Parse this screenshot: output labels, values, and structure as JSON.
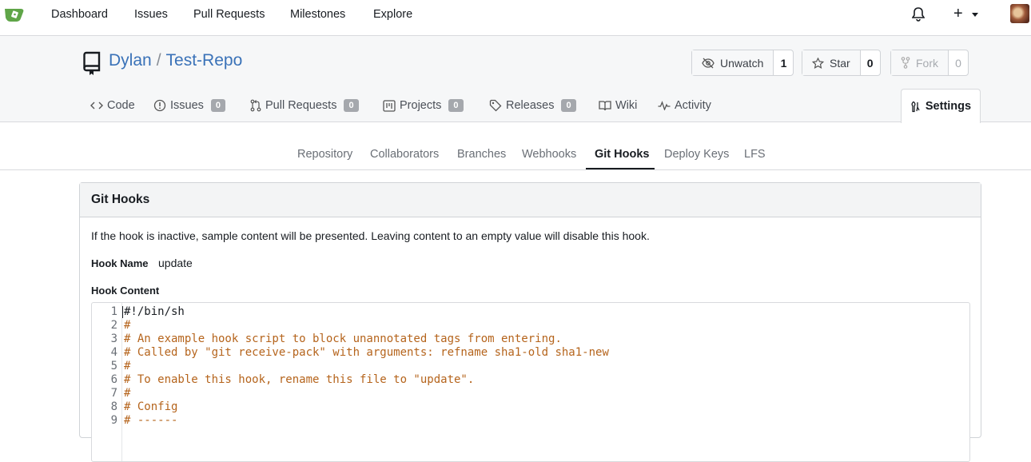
{
  "nav": {
    "items": [
      "Dashboard",
      "Issues",
      "Pull Requests",
      "Milestones",
      "Explore"
    ],
    "plus": "+"
  },
  "repo": {
    "owner": "Dylan",
    "separator": "/",
    "name": "Test-Repo",
    "watch": {
      "label": "Unwatch",
      "count": "1"
    },
    "star": {
      "label": "Star",
      "count": "0"
    },
    "fork": {
      "label": "Fork",
      "count": "0"
    }
  },
  "tabs": {
    "code": "Code",
    "issues": {
      "label": "Issues",
      "count": "0"
    },
    "pulls": {
      "label": "Pull Requests",
      "count": "0"
    },
    "projects": {
      "label": "Projects",
      "count": "0"
    },
    "releases": {
      "label": "Releases",
      "count": "0"
    },
    "wiki": "Wiki",
    "activity": "Activity",
    "settings": "Settings"
  },
  "subnav": {
    "items": [
      "Repository",
      "Collaborators",
      "Branches",
      "Webhooks",
      "Git Hooks",
      "Deploy Keys",
      "LFS"
    ],
    "active": "Git Hooks"
  },
  "panel": {
    "title": "Git Hooks",
    "description": "If the hook is inactive, sample content will be presented. Leaving content to an empty value will disable this hook.",
    "hook_name_label": "Hook Name",
    "hook_name_value": "update",
    "hook_content_label": "Hook Content"
  },
  "editor": {
    "lines": [
      {
        "n": "1",
        "text": "#!/bin/sh"
      },
      {
        "n": "2",
        "text": "#"
      },
      {
        "n": "3",
        "text": "# An example hook script to block unannotated tags from entering."
      },
      {
        "n": "4",
        "text": "# Called by \"git receive-pack\" with arguments: refname sha1-old sha1-new"
      },
      {
        "n": "5",
        "text": "#"
      },
      {
        "n": "6",
        "text": "# To enable this hook, rename this file to \"update\"."
      },
      {
        "n": "7",
        "text": "#"
      },
      {
        "n": "8",
        "text": "# Config"
      },
      {
        "n": "9",
        "text": "# ------"
      }
    ]
  },
  "colors": {
    "link": "#3a72b8",
    "comment": "#b5641c",
    "logo": "#5fa548"
  }
}
